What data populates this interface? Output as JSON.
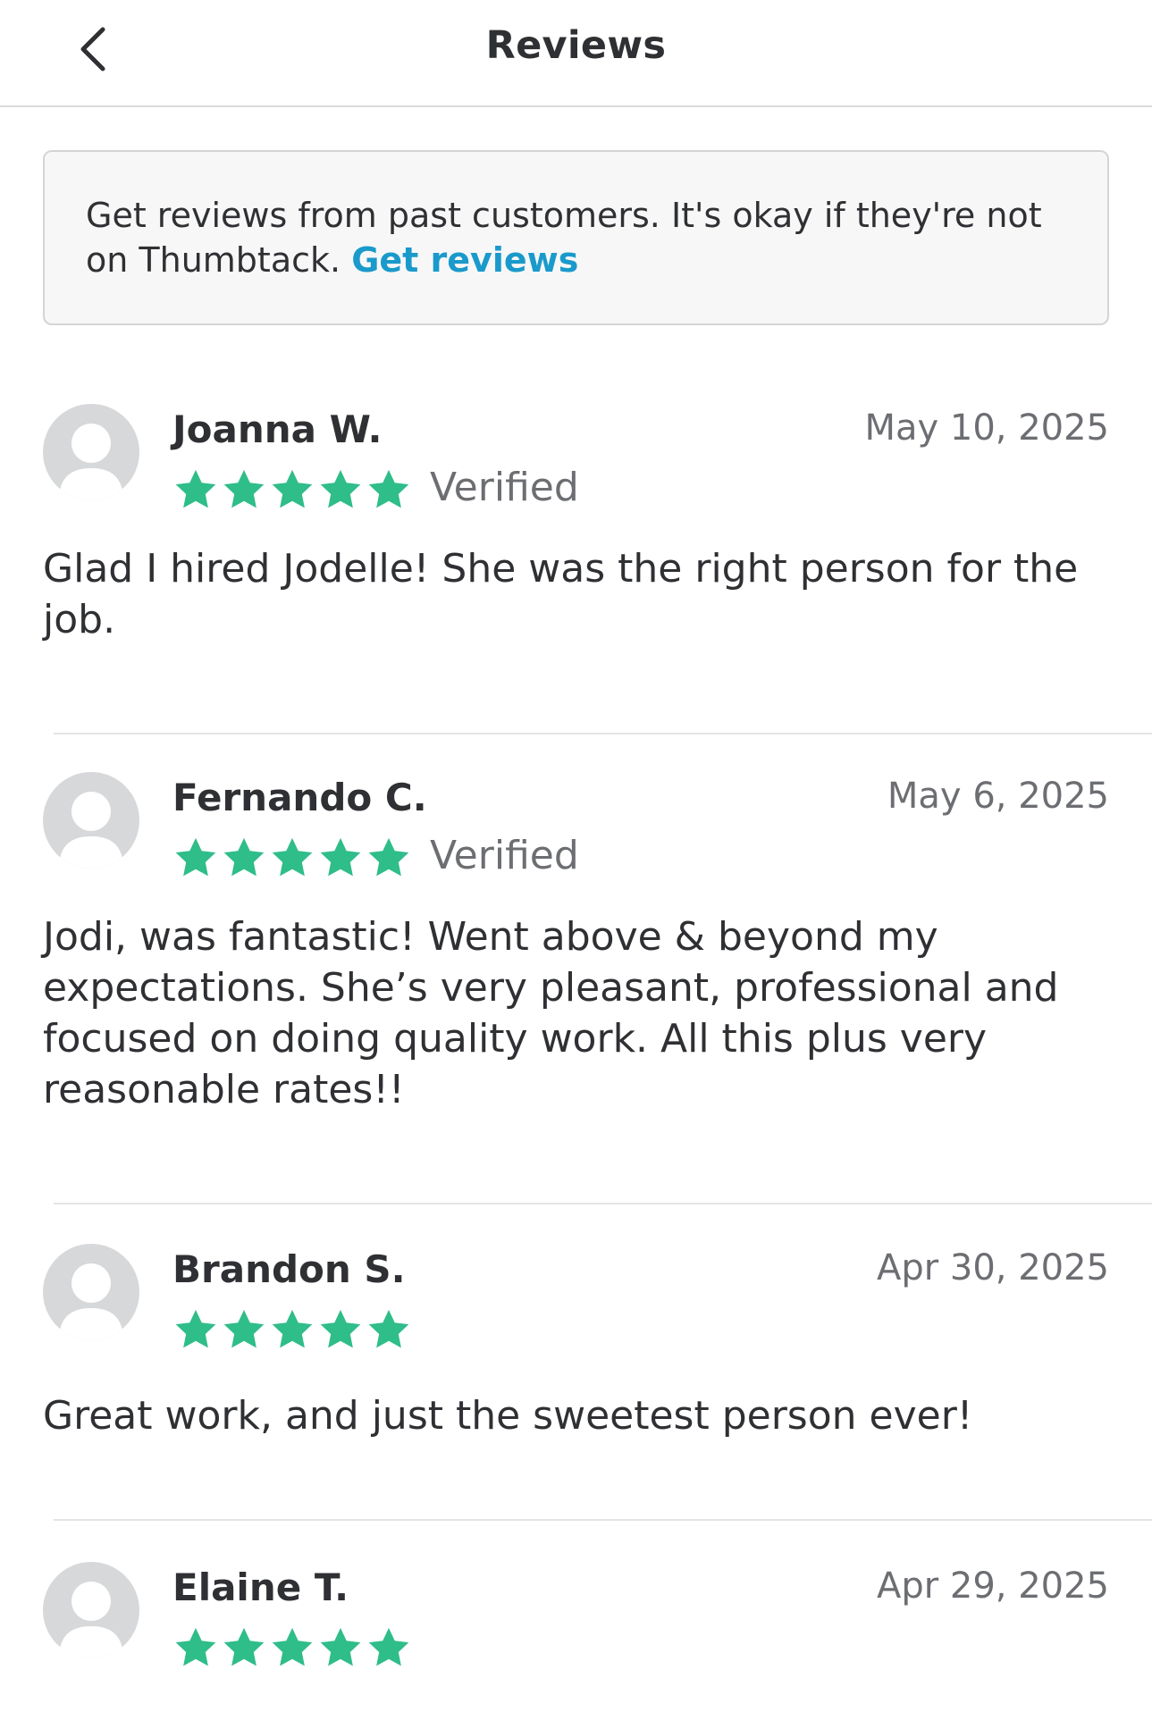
{
  "header": {
    "title": "Reviews"
  },
  "banner": {
    "text": "Get reviews from past customers. It's okay if they're not on Thumbtack.",
    "link_label": "Get reviews"
  },
  "colors": {
    "star": "#2fbd8a",
    "link": "#1a9acb"
  },
  "reviews": [
    {
      "name": "Joanna W.",
      "date": "May 10, 2025",
      "rating": 5,
      "verified": "Verified",
      "text": "Glad I hired Jodelle! She was the right person for the job."
    },
    {
      "name": "Fernando C.",
      "date": "May 6, 2025",
      "rating": 5,
      "verified": "Verified",
      "text": "Jodi, was fantastic! Went above & beyond my expectations. She’s very pleasant, professional and focused on doing quality work. All this plus very reasonable rates!!"
    },
    {
      "name": "Brandon S.",
      "date": "Apr 30, 2025",
      "rating": 5,
      "verified": "",
      "text": "Great work, and just the sweetest person ever!"
    },
    {
      "name": "Elaine T.",
      "date": "Apr 29, 2025",
      "rating": 5,
      "verified": "",
      "text": ""
    }
  ]
}
